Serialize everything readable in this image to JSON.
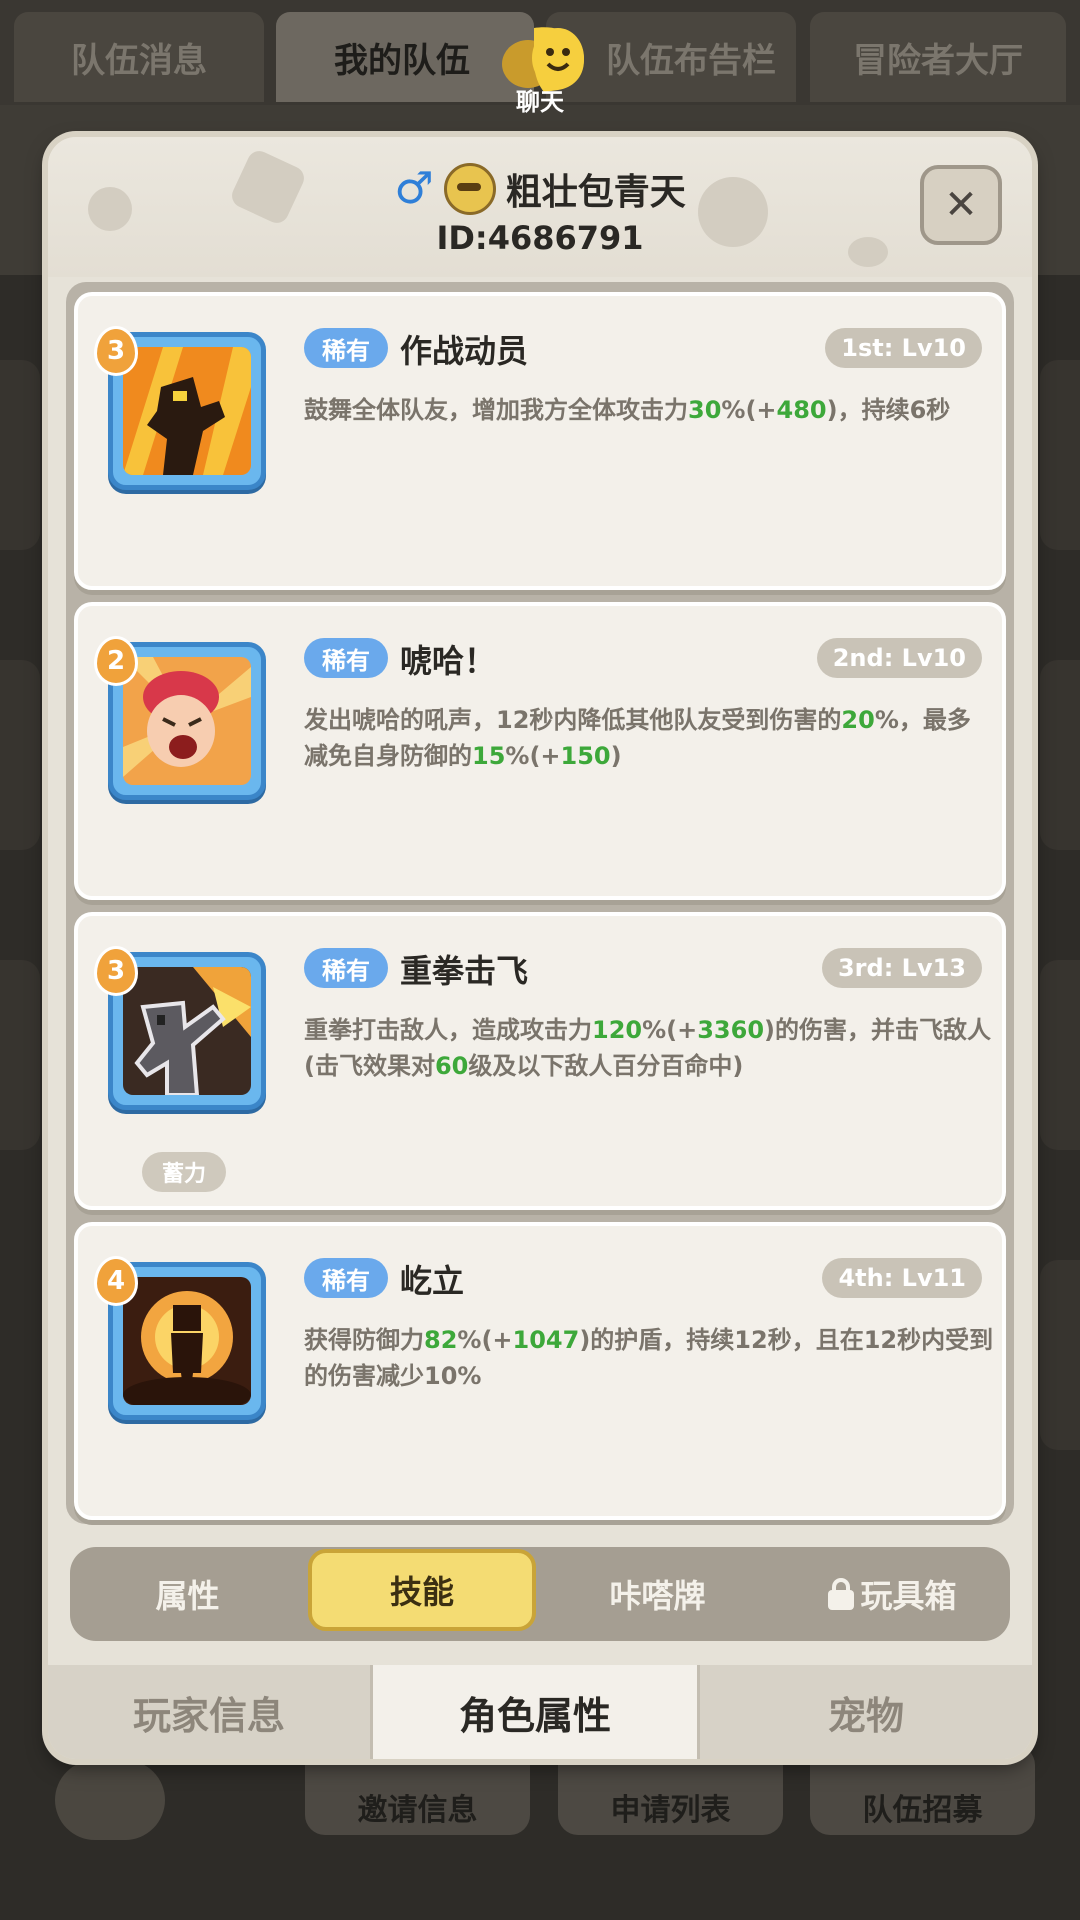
{
  "background": {
    "top_tabs": [
      "队伍消息",
      "我的队伍",
      "队伍布告栏",
      "冒险者大厅"
    ],
    "active_top_tab": "我的队伍",
    "chat_label": "聊天",
    "bottom_buttons": [
      "邀请信息",
      "申请列表",
      "队伍招募"
    ]
  },
  "dialog": {
    "player_name": "粗壮包青天",
    "player_id": "ID:4686791",
    "close_label": "✕",
    "skills": [
      {
        "rank": "3",
        "rarity": "稀有",
        "name": "作战动员",
        "level": "1st: Lv10",
        "desc_parts": [
          "鼓舞全体队友，增加我方全体攻击力",
          "30",
          "%(+",
          "480",
          ")，持续6秒"
        ],
        "icon": "rally-skill-icon",
        "tag": ""
      },
      {
        "rank": "2",
        "rarity": "稀有",
        "name": "唬哈！",
        "level": "2nd: Lv10",
        "desc_parts": [
          "发出唬哈的吼声，12秒内降低其他队友受到伤害的",
          "20",
          "%，最多减免自身防御的",
          "15",
          "%(+",
          "150",
          ")"
        ],
        "icon": "shout-skill-icon",
        "tag": ""
      },
      {
        "rank": "3",
        "rarity": "稀有",
        "name": "重拳击飞",
        "level": "3rd: Lv13",
        "desc_parts": [
          "重拳打击敌人，造成攻击力",
          "120",
          "%(+",
          "3360",
          ")的伤害，并击飞敌人(击飞效果对",
          "60",
          "级及以下敌人百分百命中)"
        ],
        "icon": "punch-skill-icon",
        "tag": "蓄力"
      },
      {
        "rank": "4",
        "rarity": "稀有",
        "name": "屹立",
        "level": "4th: Lv11",
        "desc_parts": [
          "获得防御力",
          "82",
          "%(+",
          "1047",
          ")的护盾，持续12秒，且在12秒内受到的伤害减少10%"
        ],
        "icon": "stand-skill-icon",
        "tag": ""
      }
    ],
    "sub_tabs": [
      "属性",
      "技能",
      "咔嗒牌",
      "玩具箱"
    ],
    "active_sub_tab": "技能",
    "bottom_tabs": [
      "玩家信息",
      "角色属性",
      "宠物"
    ],
    "active_bottom_tab": "角色属性"
  },
  "colors": {
    "highlight_green": "#3da83a",
    "rarity_blue": "#6aa9ec",
    "active_tab_yellow": "#f4dc73",
    "rank_orange": "#f0a23b"
  }
}
